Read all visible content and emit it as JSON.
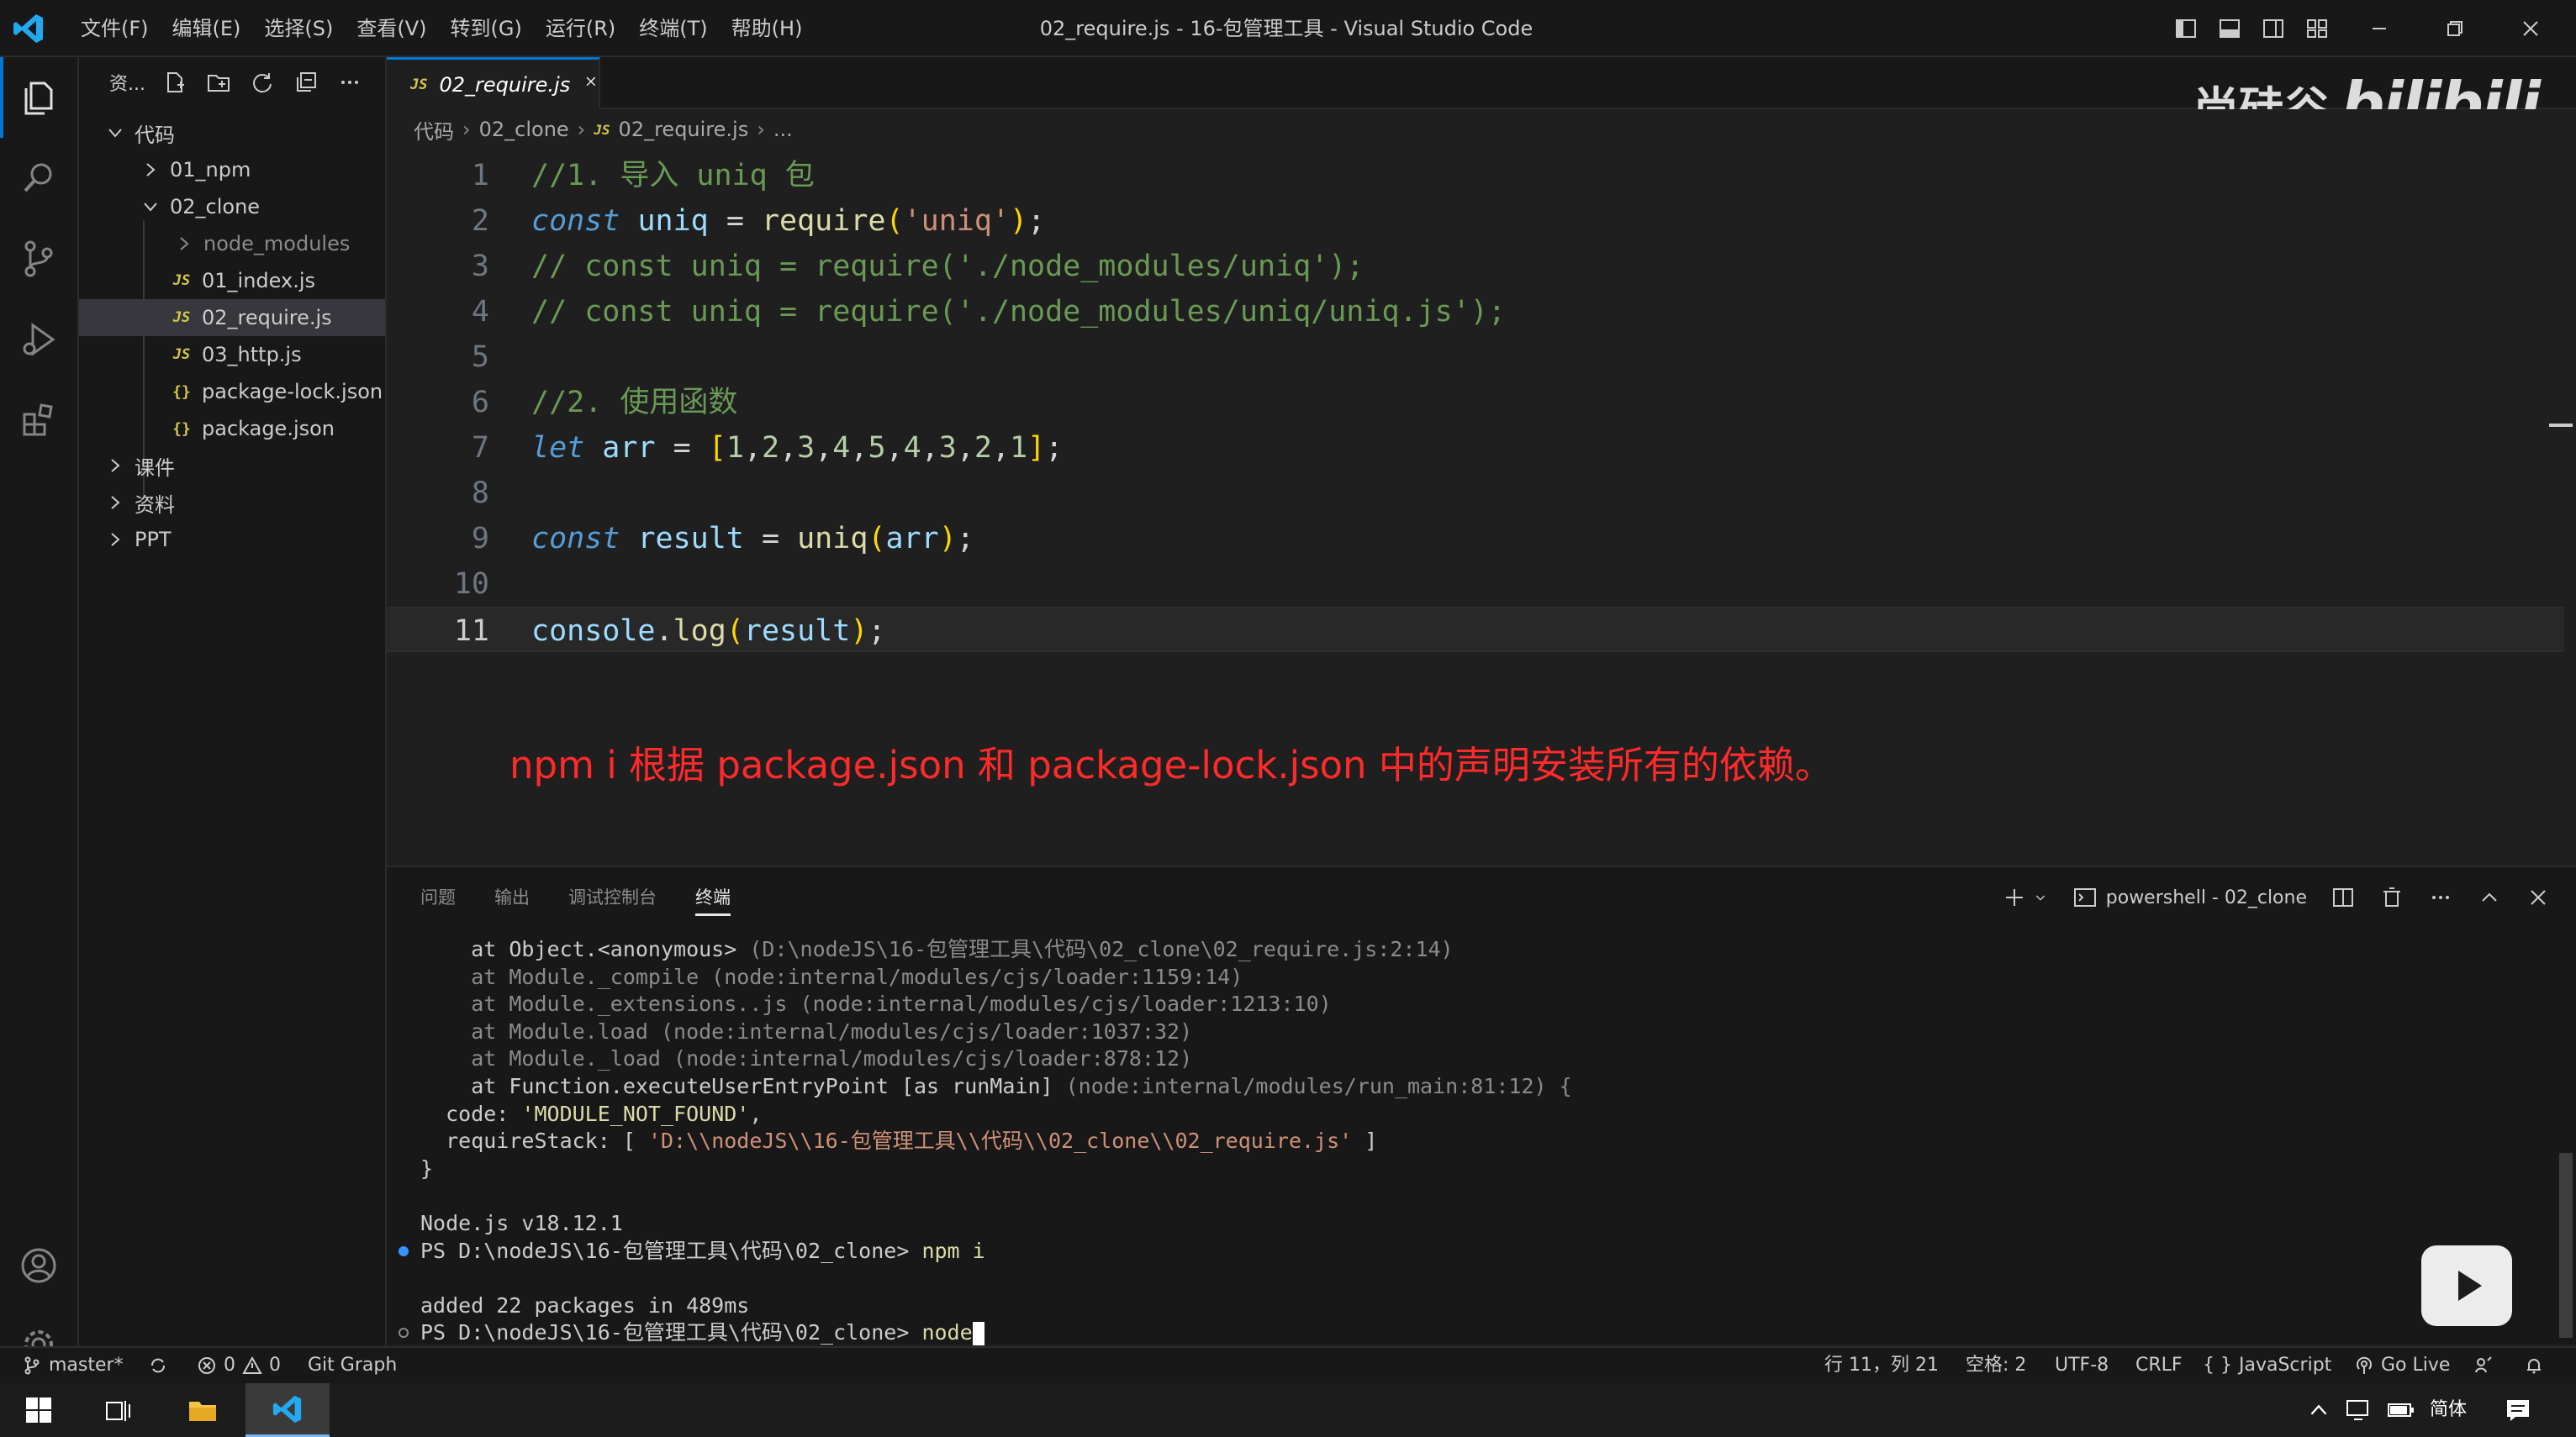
{
  "window": {
    "title": "02_require.js - 16-包管理工具 - Visual Studio Code",
    "menu": [
      "文件(F)",
      "编辑(E)",
      "选择(S)",
      "查看(V)",
      "转到(G)",
      "运行(R)",
      "终端(T)",
      "帮助(H)"
    ]
  },
  "watermark": {
    "text": "尚硅谷",
    "logo": "bilibili"
  },
  "sidebar": {
    "title": "资...",
    "tree": [
      {
        "label": "代码",
        "kind": "folder",
        "expanded": true
      },
      {
        "label": "01_npm",
        "kind": "folder",
        "expanded": false
      },
      {
        "label": "02_clone",
        "kind": "folder",
        "expanded": true
      },
      {
        "label": "node_modules",
        "kind": "folder",
        "expanded": false
      },
      {
        "label": "01_index.js",
        "kind": "js"
      },
      {
        "label": "02_require.js",
        "kind": "js",
        "selected": true
      },
      {
        "label": "03_http.js",
        "kind": "js"
      },
      {
        "label": "package-lock.json",
        "kind": "json"
      },
      {
        "label": "package.json",
        "kind": "json"
      },
      {
        "label": "课件",
        "kind": "folder",
        "expanded": false
      },
      {
        "label": "资料",
        "kind": "folder",
        "expanded": false
      },
      {
        "label": "PPT",
        "kind": "folder",
        "expanded": false
      }
    ],
    "icon_badges": {
      "js": "JS",
      "json": "{}"
    }
  },
  "editor": {
    "tab_label": "02_require.js",
    "tab_badge": "JS",
    "breadcrumb": [
      "代码",
      "02_clone",
      "02_require.js",
      "..."
    ],
    "current_line": 11,
    "annotation": "npm i 根据 package.json 和 package-lock.json 中的声明安装所有的依赖。",
    "lines": [
      {
        "n": "1",
        "text": "//1. 导入 uniq 包"
      },
      {
        "n": "2",
        "text": "const uniq = require('uniq');"
      },
      {
        "n": "3",
        "text": "// const uniq = require('./node_modules/uniq');"
      },
      {
        "n": "4",
        "text": "// const uniq = require('./node_modules/uniq/uniq.js');"
      },
      {
        "n": "5",
        "text": ""
      },
      {
        "n": "6",
        "text": "//2. 使用函数"
      },
      {
        "n": "7",
        "text": "let arr = [1,2,3,4,5,4,3,2,1];"
      },
      {
        "n": "8",
        "text": ""
      },
      {
        "n": "9",
        "text": "const result = uniq(arr);"
      },
      {
        "n": "10",
        "text": ""
      },
      {
        "n": "11",
        "text": "console.log(result);"
      }
    ]
  },
  "panel": {
    "tabs": [
      "问题",
      "输出",
      "调试控制台",
      "终端"
    ],
    "active_tab": "终端",
    "terminal_name": "powershell - 02_clone",
    "terminal_lines": [
      {
        "text": "    at Object.<anonymous> (D:\\nodeJS\\16-包管理工具\\代码\\02_clone\\02_require.js:2:14)",
        "style": "mixed"
      },
      {
        "text": "    at Module._compile (node:internal/modules/cjs/loader:1159:14)",
        "style": "gray"
      },
      {
        "text": "    at Module._extensions..js (node:internal/modules/cjs/loader:1213:10)",
        "style": "gray"
      },
      {
        "text": "    at Module.load (node:internal/modules/cjs/loader:1037:32)",
        "style": "gray"
      },
      {
        "text": "    at Module._load (node:internal/modules/cjs/loader:878:12)",
        "style": "gray"
      },
      {
        "text": "    at Function.executeUserEntryPoint [as runMain] (node:internal/modules/run_main:81:12) {",
        "style": "mixed"
      },
      {
        "text": "  code: 'MODULE_NOT_FOUND',",
        "style": "code"
      },
      {
        "text": "  requireStack: [ 'D:\\\\nodeJS\\\\16-包管理工具\\\\代码\\\\02_clone\\\\02_require.js' ]",
        "style": "stack"
      },
      {
        "text": "}",
        "style": "plain"
      },
      {
        "text": "",
        "style": "plain"
      },
      {
        "text": "Node.js v18.12.1",
        "style": "plain"
      },
      {
        "text": "PS D:\\nodeJS\\16-包管理工具\\代码\\02_clone> npm i",
        "style": "prompt"
      },
      {
        "text": "",
        "style": "plain"
      },
      {
        "text": "added 22 packages in 489ms",
        "style": "plain"
      },
      {
        "text": "PS D:\\nodeJS\\16-包管理工具\\代码\\02_clone> node",
        "style": "prompt-current"
      }
    ]
  },
  "statusbar": {
    "branch": "master*",
    "errors": "0",
    "warnings": "0",
    "git_graph": "Git Graph",
    "position": "行 11，列 21",
    "spaces": "空格: 2",
    "encoding": "UTF-8",
    "eol": "CRLF",
    "language": "JavaScript",
    "golive": "Go Live"
  },
  "taskbar": {
    "ime": "简体"
  },
  "colors": {
    "accent": "#0078d4",
    "annotation": "#ff2a2a",
    "keyword": "#569cd6",
    "comment": "#6a9955",
    "string": "#ce9178",
    "number": "#b5cea8",
    "function": "#dcdcaa",
    "variable": "#9cdcfe"
  }
}
